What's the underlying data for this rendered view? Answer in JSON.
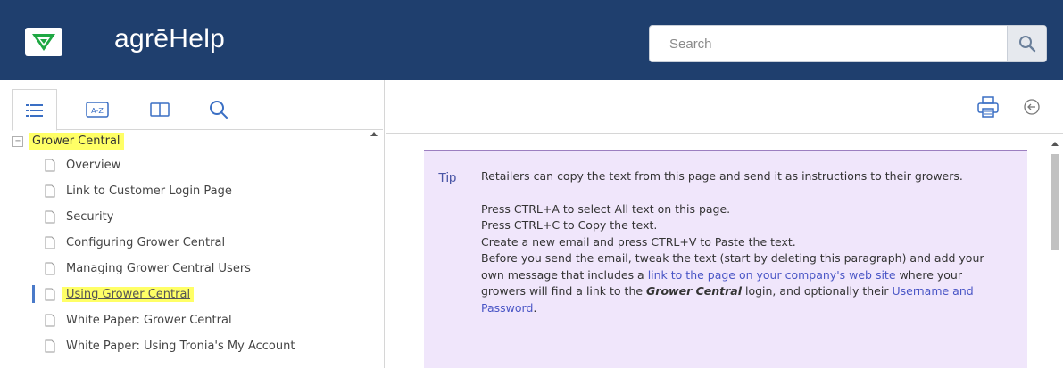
{
  "header": {
    "app_title": "agrēHelp",
    "search": {
      "placeholder": "Search",
      "value": ""
    },
    "brand_color": "#1f3f6e"
  },
  "sidebar": {
    "tabs": [
      {
        "name": "contents",
        "icon": "list-icon",
        "active": true
      },
      {
        "name": "index",
        "icon": "a-z-index-icon",
        "active": false
      },
      {
        "name": "glossary",
        "icon": "book-icon",
        "active": false
      },
      {
        "name": "search",
        "icon": "search-icon",
        "active": false
      }
    ],
    "tree": {
      "root": {
        "label": "Grower Central",
        "expander": "−"
      },
      "items": [
        {
          "label": "Overview"
        },
        {
          "label": "Link to Customer Login Page"
        },
        {
          "label": "Security"
        },
        {
          "label": "Configuring Grower Central"
        },
        {
          "label": "Managing Grower Central Users"
        },
        {
          "label": "Using Grower Central",
          "current": true
        },
        {
          "label": "White Paper: Grower Central"
        },
        {
          "label": "White Paper: Using Tronia's My Account"
        }
      ]
    },
    "highlight_color": "#ffff66"
  },
  "toolbar": {
    "print": "print-icon",
    "back": "back-arrow-icon"
  },
  "content": {
    "tip": {
      "label": "Tip",
      "intro": "Retailers can copy the text from this page and send it as instructions to their growers.",
      "line1": "Press CTRL+A to select All text on this page.",
      "line2": "Press CTRL+C to Copy the text.",
      "line3": "Create a new email and press CTRL+V to Paste the text.",
      "para_a": "Before you send the email, tweak the text (start by deleting this paragraph) and add your own message that includes a ",
      "link1": "link to the page on your company's web site",
      "para_b": " where your growers will find a link to the ",
      "bold": "Grower Central",
      "para_c": " login, and optionally their ",
      "link2": "Username and Password",
      "para_d": "."
    },
    "tip_background": "#f0e6fb"
  }
}
